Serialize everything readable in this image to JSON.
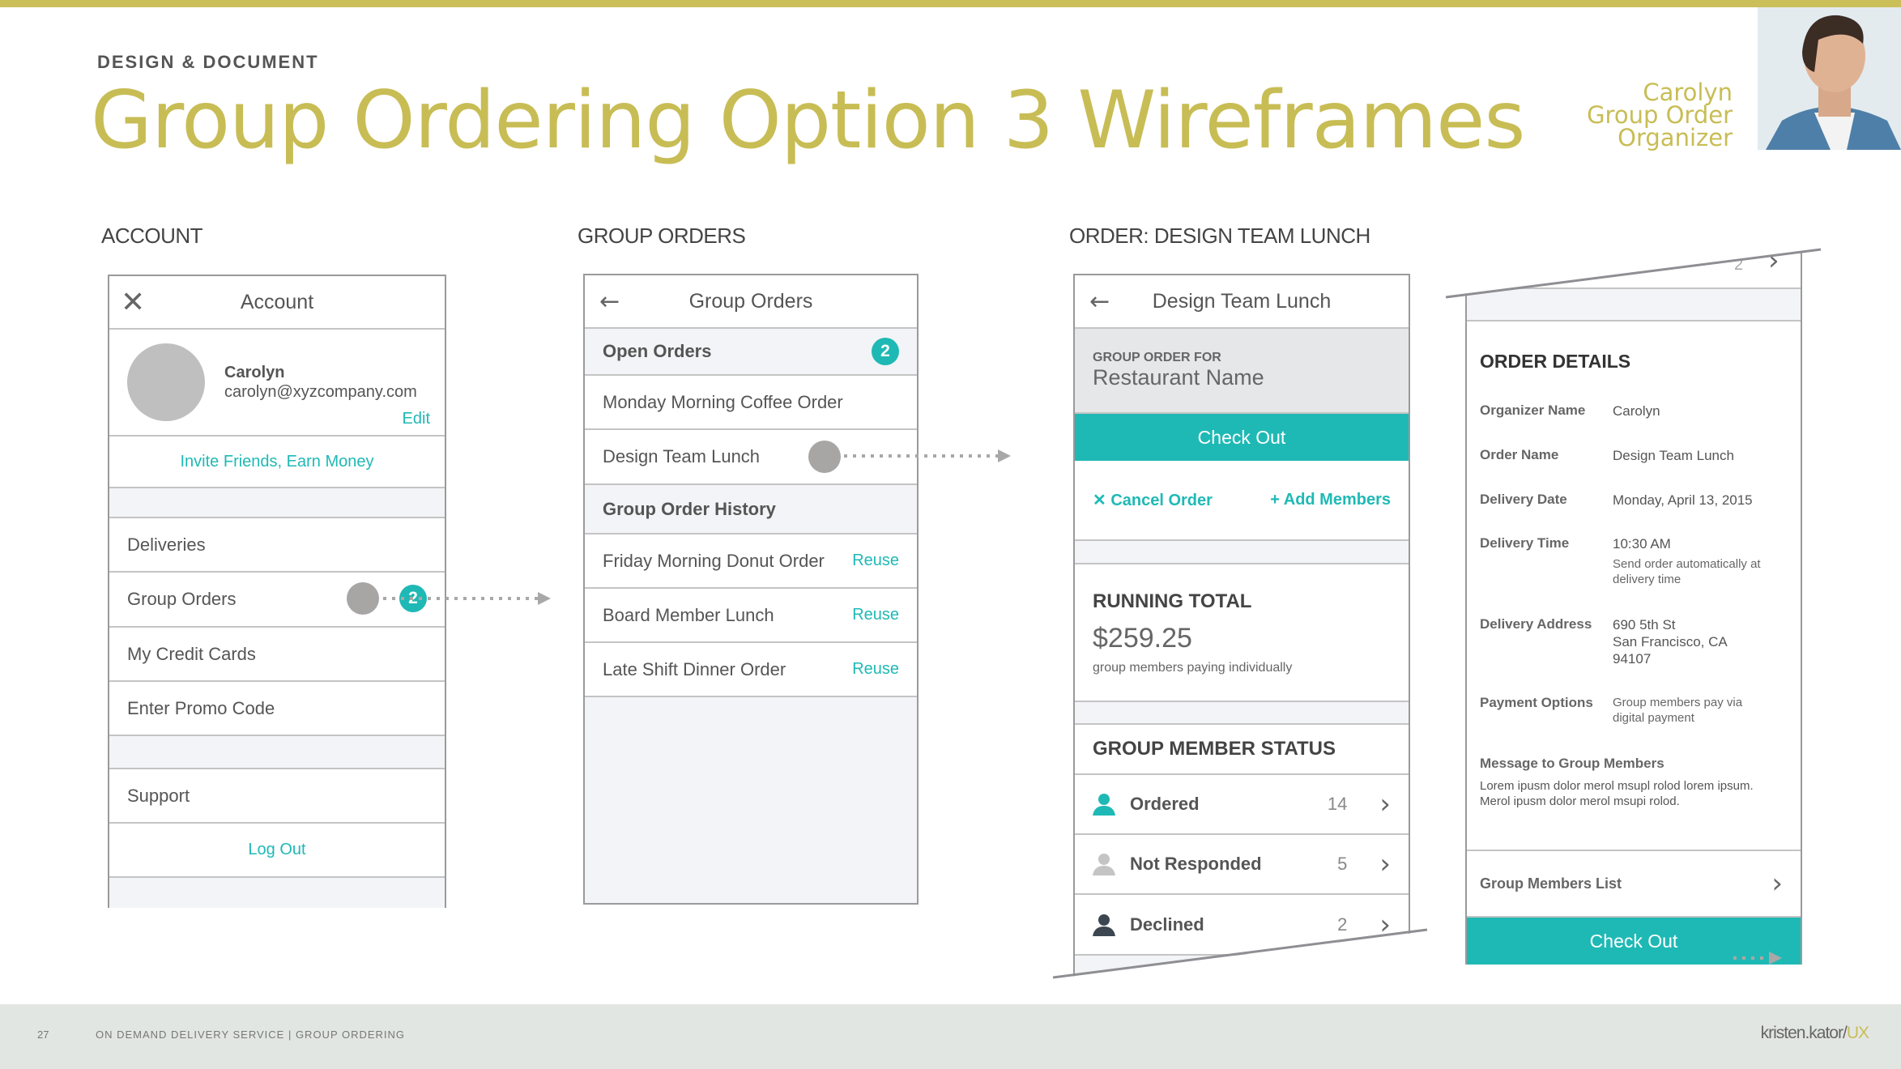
{
  "header": {
    "kicker": "DESIGN & DOCUMENT",
    "title": "Group Ordering Option 3 Wireframes",
    "persona_name": "Carolyn",
    "persona_role_1": "Group Order",
    "persona_role_2": "Organizer"
  },
  "sections": {
    "account": "ACCOUNT",
    "group_orders": "GROUP ORDERS",
    "order": "ORDER: DESIGN TEAM LUNCH"
  },
  "account": {
    "title": "Account",
    "name": "Carolyn",
    "email": "carolyn@xyzcompany.com",
    "edit": "Edit",
    "invite": "Invite Friends, Earn Money",
    "items": [
      "Deliveries",
      "Group Orders",
      "My Credit Cards",
      "Enter Promo Code",
      "Support"
    ],
    "group_orders_badge": "2",
    "logout": "Log Out"
  },
  "group_orders": {
    "title": "Group Orders",
    "open_header": "Open Orders",
    "open_count": "2",
    "open": [
      "Monday Morning Coffee Order",
      "Design Team Lunch"
    ],
    "history_header": "Group Order History",
    "history": [
      "Friday Morning Donut Order",
      "Board Member Lunch",
      "Late Shift Dinner Order"
    ],
    "reuse": "Reuse"
  },
  "order": {
    "title": "Design Team Lunch",
    "for_label": "GROUP ORDER FOR",
    "restaurant": "Restaurant Name",
    "checkout": "Check Out",
    "cancel": "Cancel Order",
    "add": "Add Members",
    "running_total_label": "RUNNING TOTAL",
    "total": "$259.25",
    "total_note": "group members paying individually",
    "status_header": "GROUP MEMBER STATUS",
    "statuses": [
      {
        "label": "Ordered",
        "count": "14",
        "color": "#1fb9b5"
      },
      {
        "label": "Not Responded",
        "count": "5",
        "color": "#c4c4c4"
      },
      {
        "label": "Declined",
        "count": "2",
        "color": "#3c4650"
      }
    ]
  },
  "details": {
    "page_num": "2",
    "heading": "ORDER DETAILS",
    "organizer_label": "Organizer Name",
    "organizer": "Carolyn",
    "order_name_label": "Order Name",
    "order_name": "Design Team Lunch",
    "date_label": "Delivery Date",
    "date": "Monday, April 13, 2015",
    "time_label": "Delivery Time",
    "time": "10:30 AM",
    "time_note": "Send order automatically at delivery time",
    "address_label": "Delivery Address",
    "address_1": "690 5th St",
    "address_2": "San Francisco, CA",
    "address_3": "94107",
    "payment_label": "Payment Options",
    "payment": "Group members pay via digital payment",
    "message_label": "Message to Group Members",
    "message": "Lorem ipusm dolor merol msupl rolod lorem ipsum. Merol ipusm dolor merol msupi rolod.",
    "members_list": "Group Members List",
    "checkout": "Check Out"
  },
  "footer": {
    "page": "27",
    "text": "ON DEMAND DELIVERY SERVICE | GROUP ORDERING",
    "brand": "kristen.kator/",
    "brand_accent": "UX"
  },
  "colors": {
    "accent": "#1fb9b5",
    "gold": "#c8bd55"
  }
}
